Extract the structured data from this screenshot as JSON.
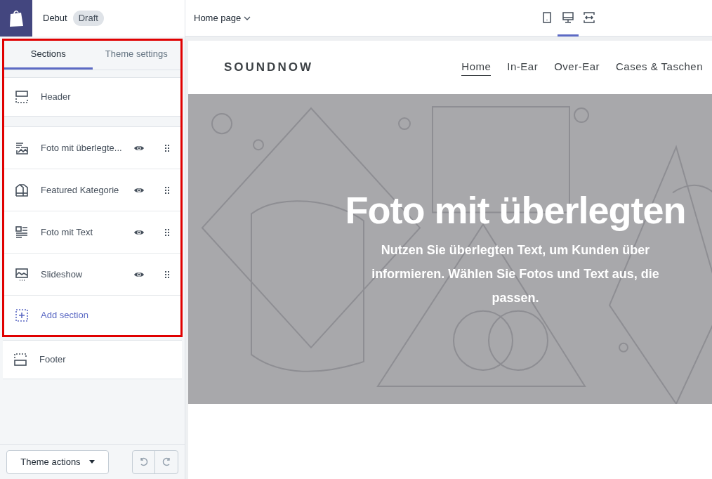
{
  "topbar": {
    "theme_name": "Debut",
    "badge": "Draft",
    "page_selector": "Home page",
    "devices": [
      {
        "kind": "mobile",
        "selected": false
      },
      {
        "kind": "desktop",
        "selected": true
      },
      {
        "kind": "fullwidth",
        "selected": false
      }
    ]
  },
  "sidebar": {
    "tabs": [
      {
        "label": "Sections",
        "selected": true
      },
      {
        "label": "Theme settings",
        "selected": false
      }
    ],
    "header_section": {
      "kind": "header",
      "label": "Header"
    },
    "sections": [
      {
        "kind": "image-overlay",
        "label": "Foto mit überlegte...",
        "visible": true
      },
      {
        "kind": "collection",
        "label": "Featured Kategorie",
        "visible": true
      },
      {
        "kind": "image-text",
        "label": "Foto mit Text",
        "visible": true
      },
      {
        "kind": "slideshow",
        "label": "Slideshow",
        "visible": true
      }
    ],
    "add_section": "Add section",
    "footer_section": {
      "kind": "footer",
      "label": "Footer"
    },
    "theme_actions": "Theme actions"
  },
  "preview": {
    "logo": "SOUNDNOW",
    "nav": [
      {
        "label": "Home",
        "selected": true
      },
      {
        "label": "In-Ear",
        "selected": false
      },
      {
        "label": "Over-Ear",
        "selected": false
      },
      {
        "label": "Cases & Taschen",
        "selected": false
      }
    ],
    "hero": {
      "title": "Foto mit überlegten",
      "text_lines": [
        "Nutzen Sie überlegten Text, um Kunden über",
        "informieren. Wählen Sie Fotos und Text aus, die",
        "passen."
      ]
    }
  }
}
